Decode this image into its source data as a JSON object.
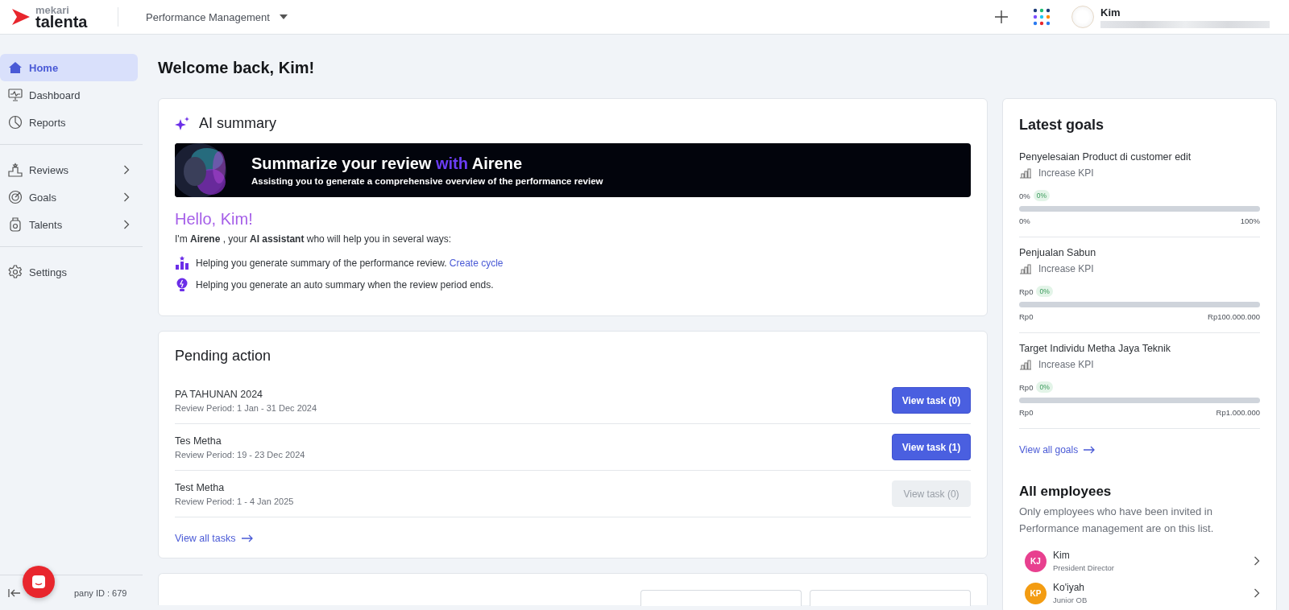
{
  "header": {
    "logo": {
      "top": "mekari",
      "bottom": "talenta"
    },
    "module": "Performance Management",
    "user": {
      "name": "Kim"
    }
  },
  "sidebar": {
    "groups": [
      {
        "items": [
          {
            "label": "Home",
            "selected": true,
            "expandable": false
          },
          {
            "label": "Dashboard",
            "selected": false,
            "expandable": false
          },
          {
            "label": "Reports",
            "selected": false,
            "expandable": false
          }
        ]
      },
      {
        "items": [
          {
            "label": "Reviews",
            "selected": false,
            "expandable": true
          },
          {
            "label": "Goals",
            "selected": false,
            "expandable": true
          },
          {
            "label": "Talents",
            "selected": false,
            "expandable": true
          }
        ]
      },
      {
        "items": [
          {
            "label": "Settings",
            "selected": false,
            "expandable": false
          }
        ]
      }
    ],
    "footer": "pany ID : 679"
  },
  "page_title": "Welcome back, Kim!",
  "ai_summary": {
    "title": "AI summary",
    "banner": {
      "before": "Summarize your review",
      "highlight": "with",
      "after": "Airene",
      "subtitle": "Assisting you to generate a comprehensive overview of the performance review"
    },
    "greeting": "Hello, Kim!",
    "intro": "I'm **Airene** , your **AI assistant** who will help you in several ways:",
    "points": [
      {
        "text": "Helping you generate summary of the performance review.",
        "link": "Create cycle"
      },
      {
        "text": "Helping you generate an auto summary when the review period ends."
      }
    ]
  },
  "pending_action": {
    "title": "Pending action",
    "tasks": [
      {
        "name": "PA TAHUNAN 2024",
        "period": "Review Period: 1 Jan - 31 Dec 2024",
        "button": "View task (0)",
        "disabled": false
      },
      {
        "name": "Tes Metha",
        "period": "Review Period: 19 - 23 Dec 2024",
        "button": "View task (1)",
        "disabled": false
      },
      {
        "name": "Test Metha",
        "period": "Review Period: 1 - 4 Jan 2025",
        "button": "View task (0)",
        "disabled": true
      }
    ],
    "link": "View all tasks"
  },
  "latest_goals": {
    "title": "Latest goals",
    "goals": [
      {
        "name": "Penyelesaian Product di customer edit",
        "type": "Increase KPI",
        "current": "0%",
        "badge": "0%",
        "level": 0,
        "min": "0%",
        "max": "100%"
      },
      {
        "name": "Penjualan Sabun",
        "type": "Increase KPI",
        "current": "Rp0",
        "badge": "0%",
        "level": 0,
        "min": "Rp0",
        "max": "Rp100.000.000"
      },
      {
        "name": "Target Individu Metha Jaya Teknik",
        "type": "Increase KPI",
        "current": "Rp0",
        "badge": "0%",
        "level": 0,
        "min": "Rp0",
        "max": "Rp1.000.000"
      }
    ],
    "link": "View all goals"
  },
  "all_employees": {
    "title": "All employees",
    "description": "Only employees who have been invited in Performance management are on this list.",
    "employees": [
      {
        "initials": "KJ",
        "name": "Kim",
        "role": "President Director",
        "color": "#e8408f"
      },
      {
        "initials": "KP",
        "name": "Ko'iyah",
        "role": "Junior OB",
        "color": "#f39c12"
      }
    ]
  }
}
